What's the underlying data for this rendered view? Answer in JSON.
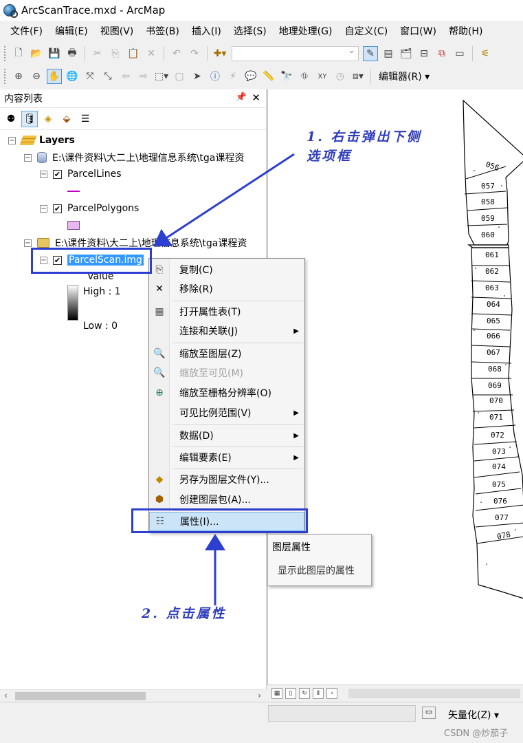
{
  "window": {
    "title": "ArcScanTrace.mxd - ArcMap"
  },
  "menu": [
    "文件(F)",
    "编辑(E)",
    "视图(V)",
    "书签(B)",
    "插入(I)",
    "选择(S)",
    "地理处理(G)",
    "自定义(C)",
    "窗口(W)",
    "帮助(H)"
  ],
  "toolbar2": {
    "editor_label": "编辑器(R) ▾"
  },
  "toc": {
    "title": "内容列表",
    "pin": "ₐ",
    "close": "✕",
    "layers_root": "Layers",
    "db1_path": "E:\\课件资料\\大二上\\地理信息系统\\tga课程资",
    "parcel_lines": "ParcelLines",
    "parcel_polygons": "ParcelPolygons",
    "folder_path": "E:\\课件资料\\大二上\\地理信息系统\\tga课程资",
    "parcel_scan": "ParcelScan.img",
    "legend_value": "Value",
    "legend_high": "High : 1",
    "legend_low": "Low : 0"
  },
  "context_menu": {
    "items": [
      {
        "label": "复制(C)",
        "icon": "copy-icon"
      },
      {
        "label": "移除(R)",
        "icon": "remove-icon"
      },
      {
        "label": "打开属性表(T)",
        "icon": "table-icon"
      },
      {
        "label": "连接和关联(J)",
        "icon": ""
      },
      {
        "label": "缩放至图层(Z)",
        "icon": "zoom-layer-icon"
      },
      {
        "label": "缩放至可见(M)",
        "icon": "zoom-visible-icon"
      },
      {
        "label": "缩放至栅格分辨率(O)",
        "icon": "zoom-raster-icon"
      },
      {
        "label": "可见比例范围(V)",
        "icon": ""
      },
      {
        "label": "数据(D)",
        "icon": ""
      },
      {
        "label": "编辑要素(E)",
        "icon": ""
      },
      {
        "label": "另存为图层文件(Y)...",
        "icon": "save-layer-icon"
      },
      {
        "label": "创建图层包(A)...",
        "icon": "package-icon"
      },
      {
        "label": "属性(I)...",
        "icon": "properties-icon"
      }
    ]
  },
  "tooltip": {
    "title": "图层属性",
    "description": "显示此图层的属性"
  },
  "status": {
    "vectorize_label": "矢量化(Z) ▾"
  },
  "watermark": "CSDN @炒茄子",
  "annotations": {
    "step1_line1": "1. 右击弹出下侧",
    "step1_line2": "选项框",
    "step2": "2. 点击属性",
    "color": "#2d3fd0"
  },
  "map_labels": [
    "056",
    "057",
    "058",
    "059",
    "060",
    "061",
    "062",
    "063",
    "064",
    "065",
    "066",
    "067",
    "068",
    "069",
    "070",
    "071",
    "072",
    "073",
    "074",
    "075",
    "076",
    "077",
    "078"
  ]
}
